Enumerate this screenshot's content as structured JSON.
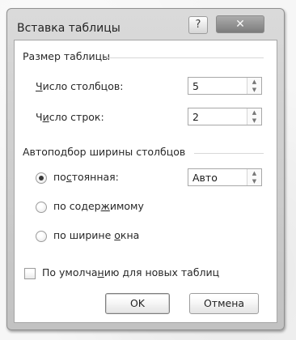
{
  "dialog": {
    "title": "Вставка таблицы",
    "help_glyph": "?",
    "close_glyph": "✕"
  },
  "table_size": {
    "section_label": "Размер таблицы",
    "columns": {
      "label_accel": "Ч",
      "label_rest": "исло столбцов:",
      "value": "5"
    },
    "rows": {
      "label_prefix": "Ч",
      "label_accel": "и",
      "label_rest": "сло строк:",
      "value": "2"
    }
  },
  "autofit": {
    "section_label": "Автоподбор ширины столбцов",
    "fixed": {
      "label_prefix": "по",
      "label_accel": "с",
      "label_rest": "тоянная:",
      "selected": true,
      "value": "Авто"
    },
    "contents": {
      "label_prefix": "по содер",
      "label_accel": "ж",
      "label_rest": "имому",
      "selected": false
    },
    "window": {
      "label_prefix": "по ширине ",
      "label_accel": "о",
      "label_rest": "кна",
      "selected": false
    }
  },
  "remember": {
    "label_prefix": "По умолча",
    "label_accel": "н",
    "label_rest": "ию для новых таблиц",
    "checked": false
  },
  "buttons": {
    "ok": "OK",
    "cancel": "Отмена"
  },
  "icons": {
    "spin_up": "▲",
    "spin_down": "▼"
  }
}
